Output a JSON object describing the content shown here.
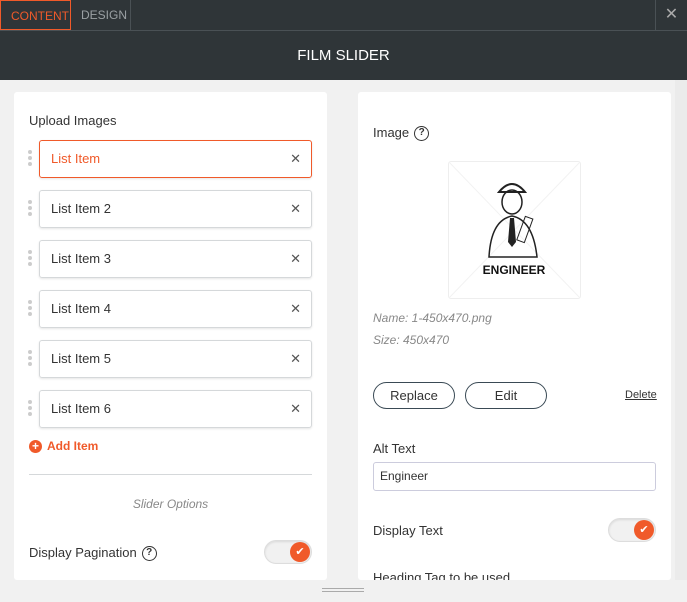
{
  "tabs": [
    {
      "label": "CONTENT",
      "active": true
    },
    {
      "label": "DESIGN",
      "active": false
    }
  ],
  "close_icon": "close-icon",
  "header": {
    "title": "FILM SLIDER"
  },
  "left": {
    "upload_label": "Upload Images",
    "items": [
      "List Item",
      "List Item 2",
      "List Item 3",
      "List Item 4",
      "List Item 5",
      "List Item 6"
    ],
    "add_item": "Add Item",
    "slider_options": "Slider Options",
    "display_pagination": "Display Pagination",
    "display_pagination_on": true
  },
  "right": {
    "image_label": "Image",
    "image_caption": "ENGINEER",
    "name": "Name: 1-450x470.png",
    "size": "Size: 450x470",
    "replace": "Replace",
    "edit": "Edit",
    "delete": "Delete",
    "alt_label": "Alt Text",
    "alt_value": "Engineer",
    "display_text": "Display Text",
    "display_text_on": true,
    "heading_tag": "Heading Tag to be used"
  },
  "colors": {
    "accent": "#f05a2a",
    "dark": "#2f3538"
  }
}
